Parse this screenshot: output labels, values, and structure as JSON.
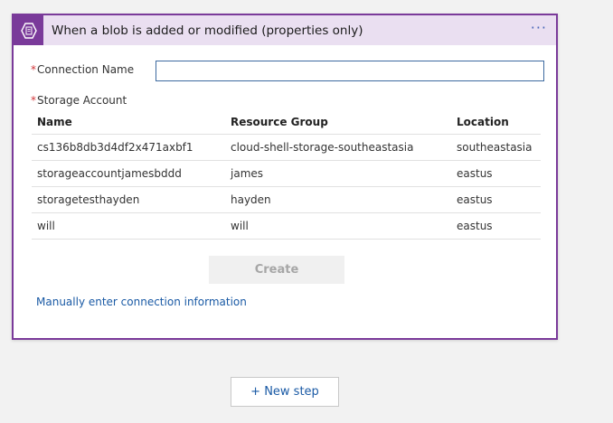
{
  "trigger": {
    "title": "When a blob is added or modified (properties only)",
    "icon": "storage-blob-icon",
    "more_label": "···",
    "accent_color": "#7a3a9a",
    "header_bg": "#eadff1"
  },
  "form": {
    "required_marker": "*",
    "connection_name_label": "Connection Name",
    "connection_name_value": "",
    "storage_account_label": "Storage Account"
  },
  "table": {
    "headers": [
      "Name",
      "Resource Group",
      "Location"
    ],
    "rows": [
      [
        "cs136b8db3d4df2x471axbf1",
        "cloud-shell-storage-southeastasia",
        "southeastasia"
      ],
      [
        "storageaccountjamesbddd",
        "james",
        "eastus"
      ],
      [
        "storagetesthayden",
        "hayden",
        "eastus"
      ],
      [
        "will",
        "will",
        "eastus"
      ]
    ]
  },
  "actions": {
    "create_label": "Create",
    "manual_link_label": "Manually enter connection information",
    "new_step_label": "+ New step"
  }
}
